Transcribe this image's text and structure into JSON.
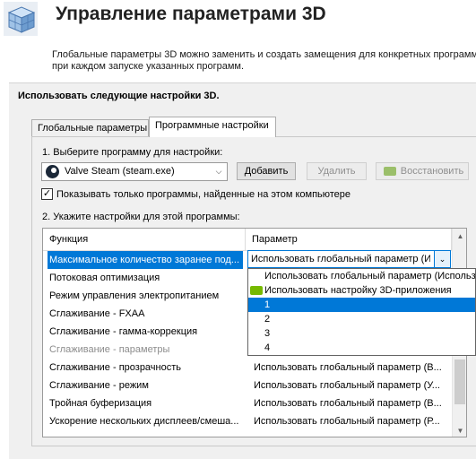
{
  "header": {
    "title": "Управление параметрами 3D",
    "logo_icon": "nvidia-3d-cube-icon"
  },
  "description": {
    "line1": "Глобальные параметры 3D можно заменить и создать замещения для конкретных программ",
    "line2": "при каждом запуске указанных программ."
  },
  "panel": {
    "title": "Использовать следующие настройки 3D."
  },
  "tabs": [
    {
      "label": "Глобальные параметры",
      "active": false
    },
    {
      "label": "Программные настройки",
      "active": true
    }
  ],
  "program_settings": {
    "step1_label": "1. Выберите программу для настройки:",
    "program_select": {
      "value": "Valve Steam (steam.exe)",
      "icon": "steam-icon"
    },
    "add_button": "Добавить",
    "remove_button": "Удалить",
    "restore_button": "Восстановить",
    "show_found_checkbox": {
      "label": "Показывать только программы, найденные на этом компьютере",
      "checked": true
    },
    "step2_label": "2. Укажите настройки для этой программы:"
  },
  "table": {
    "columns": [
      "Функция",
      "Параметр"
    ],
    "rows": [
      {
        "func": "Максимальное количество заранее под...",
        "param": "Использовать глобальный параметр (Ис",
        "selected": true
      },
      {
        "func": "Потоковая оптимизация",
        "param": ""
      },
      {
        "func": "Режим управления электропитанием",
        "param": ""
      },
      {
        "func": "Сглаживание - FXAA",
        "param": ""
      },
      {
        "func": "Сглаживание - гамма-коррекция",
        "param": ""
      },
      {
        "func": "Сглаживание - параметры",
        "param": "",
        "disabled": true
      },
      {
        "func": "Сглаживание - прозрачность",
        "param": "Использовать глобальный параметр (В..."
      },
      {
        "func": "Сглаживание - режим",
        "param": "Использовать глобальный параметр (У..."
      },
      {
        "func": "Тройная буферизация",
        "param": "Использовать глобальный параметр (В..."
      },
      {
        "func": "Ускорение нескольких дисплеев/смеша...",
        "param": "Использовать глобальный параметр (Р..."
      }
    ]
  },
  "dropdown": {
    "options": [
      {
        "label": "Использовать глобальный параметр (Использо",
        "icon": "",
        "highlight": false
      },
      {
        "label": "Использовать настройку 3D-приложения",
        "icon": "nvidia-icon",
        "highlight": false
      },
      {
        "label": "1",
        "icon": "",
        "highlight": true
      },
      {
        "label": "2",
        "icon": "",
        "highlight": false
      },
      {
        "label": "3",
        "icon": "",
        "highlight": false
      },
      {
        "label": "4",
        "icon": "",
        "highlight": false
      }
    ]
  },
  "colors": {
    "selection": "#0078d7",
    "nvidia_green": "#76b900"
  }
}
